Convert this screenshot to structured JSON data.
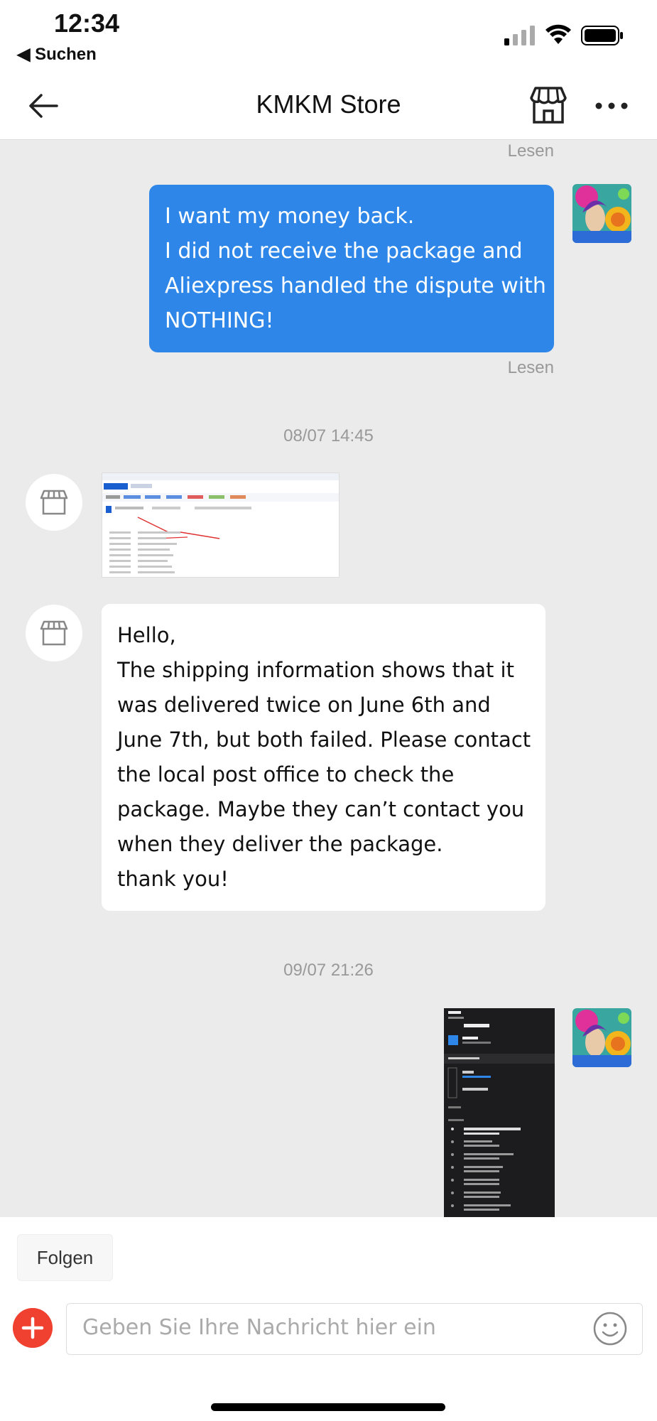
{
  "status_bar": {
    "time": "12:34",
    "back_app": "◀ Suchen"
  },
  "nav": {
    "title": "KMKM Store"
  },
  "chat": {
    "read_label_1": "Lesen",
    "read_label_2": "Lesen",
    "user_message_lines": [
      "I want my money back.",
      "I did not receive the package and",
      "Aliexpress handled the dispute with",
      "NOTHING!"
    ],
    "date_1": "08/07 14:45",
    "store_message_lines": [
      "Hello,",
      "The shipping information shows that it",
      "was delivered twice on June 6th and",
      "June 7th, but both failed. Please contact",
      "the local post office to check the",
      "package. Maybe they can’t contact you",
      "when they deliver the package.",
      "thank you!"
    ],
    "date_2": "09/07 21:26"
  },
  "bottom": {
    "follow_label": "Folgen",
    "input_placeholder": "Geben Sie Ihre Nachricht hier ein"
  },
  "colors": {
    "bubble_blue": "#2e87e8",
    "add_red": "#f0402f",
    "chat_bg": "#ebebeb"
  }
}
